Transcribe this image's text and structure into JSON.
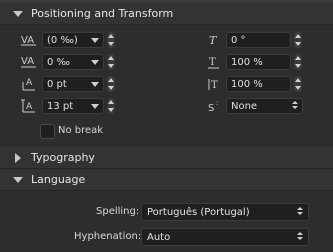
{
  "sections": {
    "positioning": {
      "title": "Positioning and Transform"
    },
    "typography": {
      "title": "Typography"
    },
    "language": {
      "title": "Language"
    }
  },
  "positioning": {
    "tracking": {
      "value": "(0 ‰)",
      "icon": "tracking-icon"
    },
    "kerning": {
      "value": "0 ‰",
      "icon": "kerning-icon"
    },
    "baseline_shift": {
      "value": "0 pt",
      "icon": "baseline-shift-icon"
    },
    "leading": {
      "value": "13 pt",
      "icon": "leading-icon"
    },
    "shear": {
      "value": "0 °",
      "icon": "shear-icon"
    },
    "horizontal_scale": {
      "value": "100 %",
      "icon": "horizontal-scale-icon"
    },
    "vertical_scale": {
      "value": "100 %",
      "icon": "vertical-scale-icon"
    },
    "superscript_subscript": {
      "value": "None",
      "icon": "superscript-icon"
    },
    "no_break_label": "No break"
  },
  "language": {
    "spelling_label": "Spelling:",
    "spelling_value": "Português (Portugal)",
    "hyphenation_label": "Hyphenation:",
    "hyphenation_value": "Auto"
  },
  "colors": {
    "panel_bg": "#2d2d2d",
    "field_bg": "#1f1f1f",
    "text": "#dcdcdc"
  }
}
